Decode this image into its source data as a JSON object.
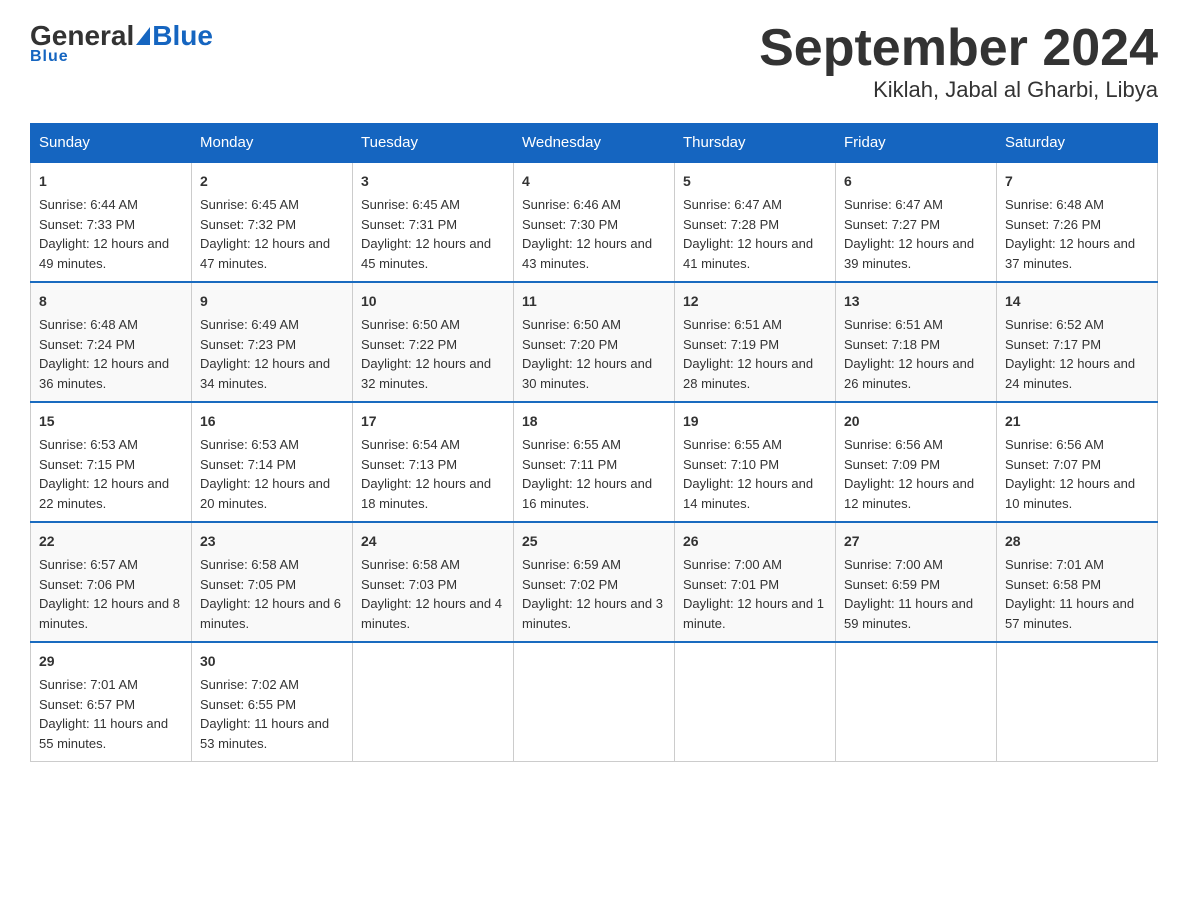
{
  "logo": {
    "general": "General",
    "blue": "Blue"
  },
  "title": "September 2024",
  "subtitle": "Kiklah, Jabal al Gharbi, Libya",
  "days_of_week": [
    "Sunday",
    "Monday",
    "Tuesday",
    "Wednesday",
    "Thursday",
    "Friday",
    "Saturday"
  ],
  "weeks": [
    [
      {
        "day": "1",
        "sunrise": "6:44 AM",
        "sunset": "7:33 PM",
        "daylight": "12 hours and 49 minutes."
      },
      {
        "day": "2",
        "sunrise": "6:45 AM",
        "sunset": "7:32 PM",
        "daylight": "12 hours and 47 minutes."
      },
      {
        "day": "3",
        "sunrise": "6:45 AM",
        "sunset": "7:31 PM",
        "daylight": "12 hours and 45 minutes."
      },
      {
        "day": "4",
        "sunrise": "6:46 AM",
        "sunset": "7:30 PM",
        "daylight": "12 hours and 43 minutes."
      },
      {
        "day": "5",
        "sunrise": "6:47 AM",
        "sunset": "7:28 PM",
        "daylight": "12 hours and 41 minutes."
      },
      {
        "day": "6",
        "sunrise": "6:47 AM",
        "sunset": "7:27 PM",
        "daylight": "12 hours and 39 minutes."
      },
      {
        "day": "7",
        "sunrise": "6:48 AM",
        "sunset": "7:26 PM",
        "daylight": "12 hours and 37 minutes."
      }
    ],
    [
      {
        "day": "8",
        "sunrise": "6:48 AM",
        "sunset": "7:24 PM",
        "daylight": "12 hours and 36 minutes."
      },
      {
        "day": "9",
        "sunrise": "6:49 AM",
        "sunset": "7:23 PM",
        "daylight": "12 hours and 34 minutes."
      },
      {
        "day": "10",
        "sunrise": "6:50 AM",
        "sunset": "7:22 PM",
        "daylight": "12 hours and 32 minutes."
      },
      {
        "day": "11",
        "sunrise": "6:50 AM",
        "sunset": "7:20 PM",
        "daylight": "12 hours and 30 minutes."
      },
      {
        "day": "12",
        "sunrise": "6:51 AM",
        "sunset": "7:19 PM",
        "daylight": "12 hours and 28 minutes."
      },
      {
        "day": "13",
        "sunrise": "6:51 AM",
        "sunset": "7:18 PM",
        "daylight": "12 hours and 26 minutes."
      },
      {
        "day": "14",
        "sunrise": "6:52 AM",
        "sunset": "7:17 PM",
        "daylight": "12 hours and 24 minutes."
      }
    ],
    [
      {
        "day": "15",
        "sunrise": "6:53 AM",
        "sunset": "7:15 PM",
        "daylight": "12 hours and 22 minutes."
      },
      {
        "day": "16",
        "sunrise": "6:53 AM",
        "sunset": "7:14 PM",
        "daylight": "12 hours and 20 minutes."
      },
      {
        "day": "17",
        "sunrise": "6:54 AM",
        "sunset": "7:13 PM",
        "daylight": "12 hours and 18 minutes."
      },
      {
        "day": "18",
        "sunrise": "6:55 AM",
        "sunset": "7:11 PM",
        "daylight": "12 hours and 16 minutes."
      },
      {
        "day": "19",
        "sunrise": "6:55 AM",
        "sunset": "7:10 PM",
        "daylight": "12 hours and 14 minutes."
      },
      {
        "day": "20",
        "sunrise": "6:56 AM",
        "sunset": "7:09 PM",
        "daylight": "12 hours and 12 minutes."
      },
      {
        "day": "21",
        "sunrise": "6:56 AM",
        "sunset": "7:07 PM",
        "daylight": "12 hours and 10 minutes."
      }
    ],
    [
      {
        "day": "22",
        "sunrise": "6:57 AM",
        "sunset": "7:06 PM",
        "daylight": "12 hours and 8 minutes."
      },
      {
        "day": "23",
        "sunrise": "6:58 AM",
        "sunset": "7:05 PM",
        "daylight": "12 hours and 6 minutes."
      },
      {
        "day": "24",
        "sunrise": "6:58 AM",
        "sunset": "7:03 PM",
        "daylight": "12 hours and 4 minutes."
      },
      {
        "day": "25",
        "sunrise": "6:59 AM",
        "sunset": "7:02 PM",
        "daylight": "12 hours and 3 minutes."
      },
      {
        "day": "26",
        "sunrise": "7:00 AM",
        "sunset": "7:01 PM",
        "daylight": "12 hours and 1 minute."
      },
      {
        "day": "27",
        "sunrise": "7:00 AM",
        "sunset": "6:59 PM",
        "daylight": "11 hours and 59 minutes."
      },
      {
        "day": "28",
        "sunrise": "7:01 AM",
        "sunset": "6:58 PM",
        "daylight": "11 hours and 57 minutes."
      }
    ],
    [
      {
        "day": "29",
        "sunrise": "7:01 AM",
        "sunset": "6:57 PM",
        "daylight": "11 hours and 55 minutes."
      },
      {
        "day": "30",
        "sunrise": "7:02 AM",
        "sunset": "6:55 PM",
        "daylight": "11 hours and 53 minutes."
      },
      null,
      null,
      null,
      null,
      null
    ]
  ]
}
